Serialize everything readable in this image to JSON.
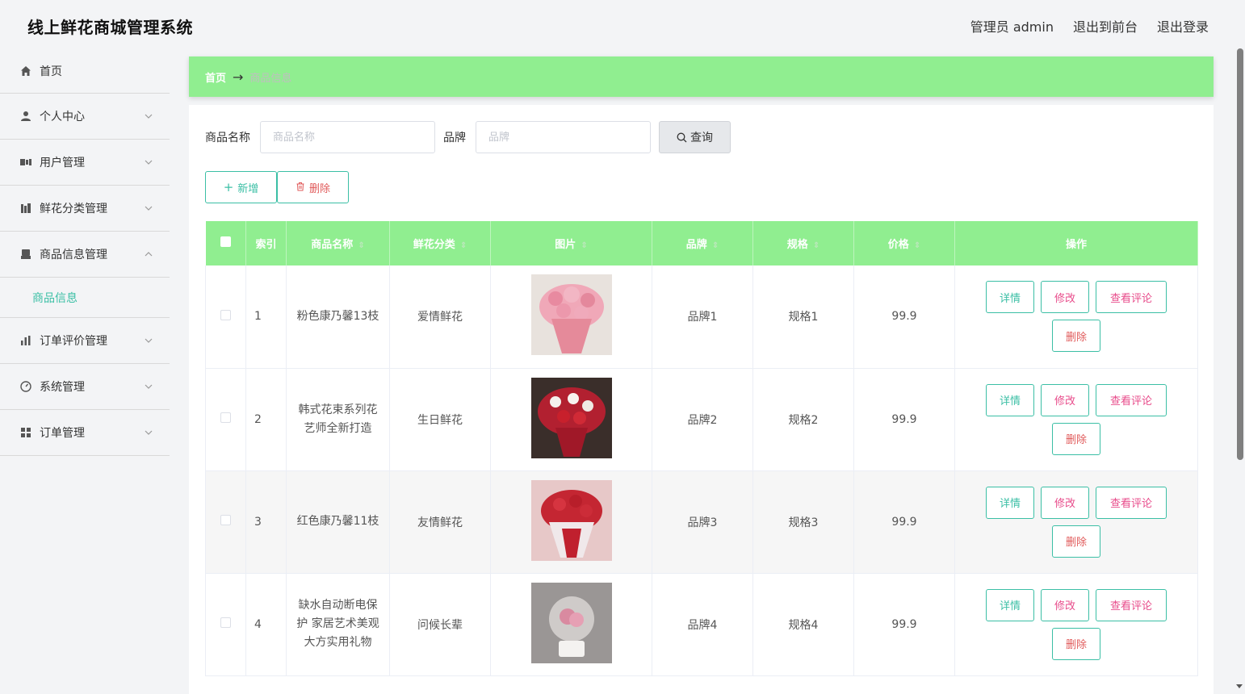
{
  "app": {
    "title": "线上鲜花商城管理系统"
  },
  "topbar": {
    "admin": "管理员 admin",
    "to_front": "退出到前台",
    "logout": "退出登录"
  },
  "sidebar": {
    "items": [
      {
        "label": "首页",
        "icon": "home-icon"
      },
      {
        "label": "个人中心",
        "icon": "user-icon"
      },
      {
        "label": "用户管理",
        "icon": "users-icon"
      },
      {
        "label": "鲜花分类管理",
        "icon": "books-icon"
      },
      {
        "label": "商品信息管理",
        "icon": "printer-icon"
      },
      {
        "label": "订单评价管理",
        "icon": "bar-chart-icon"
      },
      {
        "label": "系统管理",
        "icon": "gauge-icon"
      },
      {
        "label": "订单管理",
        "icon": "grid-icon"
      }
    ],
    "sub": {
      "label": "商品信息"
    }
  },
  "breadcrumb": {
    "home": "首页",
    "sep": "→",
    "current": "商品信息"
  },
  "search": {
    "name_label": "商品名称",
    "name_placeholder": "商品名称",
    "brand_label": "品牌",
    "brand_placeholder": "品牌",
    "query_label": "查询"
  },
  "actions": {
    "add": "新增",
    "delete": "删除"
  },
  "table": {
    "headers": [
      "索引",
      "商品名称",
      "鲜花分类",
      "图片",
      "品牌",
      "规格",
      "价格",
      "操作"
    ],
    "rows": [
      {
        "index": "1",
        "name": "粉色康乃馨13枝",
        "category": "爱情鲜花",
        "brand": "品牌1",
        "spec": "规格1",
        "price": "99.9"
      },
      {
        "index": "2",
        "name": "韩式花束系列花艺师全新打造",
        "category": "生日鲜花",
        "brand": "品牌2",
        "spec": "规格2",
        "price": "99.9"
      },
      {
        "index": "3",
        "name": "红色康乃馨11枝",
        "category": "友情鲜花",
        "brand": "品牌3",
        "spec": "规格3",
        "price": "99.9"
      },
      {
        "index": "4",
        "name": "缺水自动断电保护 家居艺术美观大方实用礼物",
        "category": "问候长辈",
        "brand": "品牌4",
        "spec": "规格4",
        "price": "99.9"
      }
    ],
    "ops": {
      "detail": "详情",
      "edit": "修改",
      "review": "查看评论",
      "delete": "删除"
    }
  },
  "colors": {
    "accent": "#90ee90",
    "teal": "#3bbfa5",
    "pink": "#e84c8b",
    "red": "#e05a5a"
  }
}
